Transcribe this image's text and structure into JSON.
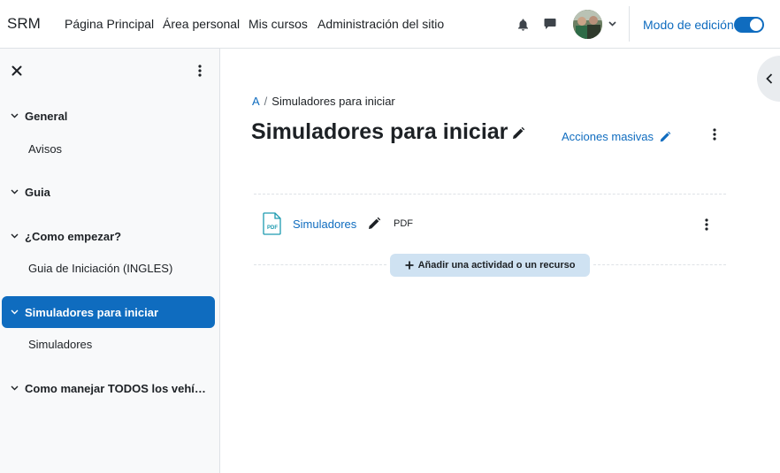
{
  "navbar": {
    "brand": "SRM",
    "links": [
      "Página Principal",
      "Área personal",
      "Mis cursos",
      "Administración del sitio"
    ],
    "icons": {
      "notifications": "bell-icon",
      "messages": "chat-icon",
      "user_menu": "chevron-down-icon"
    },
    "edit_mode_label": "Modo de edición",
    "edit_mode_on": true
  },
  "drawer": {
    "sections": [
      {
        "label": "General",
        "expanded": true,
        "items": [
          "Avisos"
        ]
      },
      {
        "label": "Guia",
        "expanded": true,
        "items": []
      },
      {
        "label": "¿Como empezar?",
        "expanded": true,
        "items": [
          "Guia de Iniciación (INGLES)"
        ]
      },
      {
        "label": "Simuladores para iniciar",
        "expanded": true,
        "active": true,
        "items": [
          "Simuladores"
        ]
      },
      {
        "label": "Como manejar TODOS los vehículos",
        "expanded": true,
        "items": []
      }
    ]
  },
  "breadcrumb": {
    "items": [
      "A",
      "Simuladores para iniciar"
    ],
    "separator": "/"
  },
  "section": {
    "title": "Simuladores para iniciar",
    "bulk_actions_label": "Acciones masivas",
    "activities": [
      {
        "name": "Simuladores",
        "type": "PDF",
        "icon": "pdf-file-icon"
      }
    ],
    "add_activity_label": "Añadir una actividad o un recurso"
  },
  "colors": {
    "primary": "#0f6cbf",
    "drawer_bg": "#f8f9fa",
    "add_button_bg": "#cfe2f2",
    "text": "#1d2125"
  }
}
